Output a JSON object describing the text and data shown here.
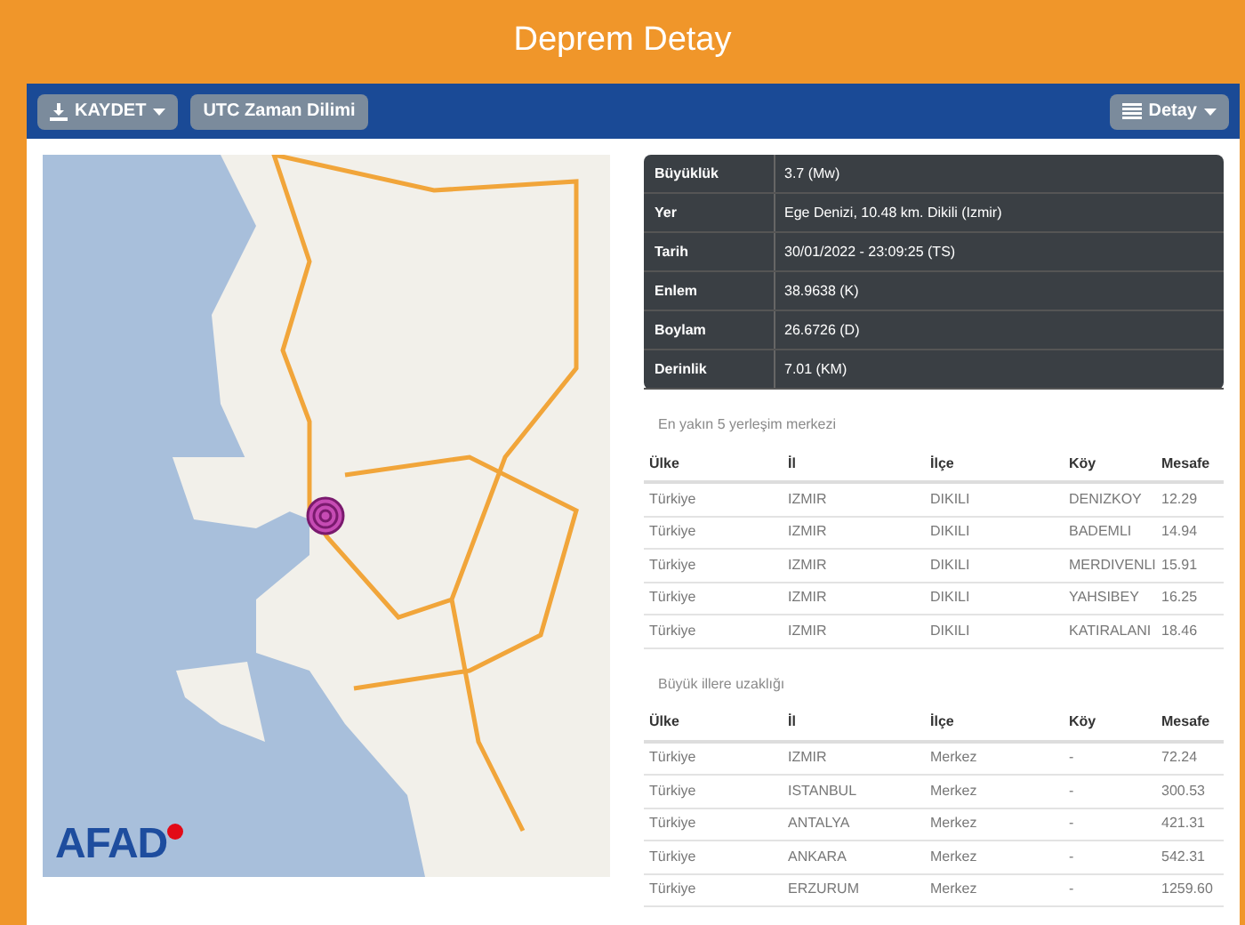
{
  "page_title": "Deprem Detay",
  "toolbar": {
    "left_buttons": [
      {
        "label": "KAYDET",
        "kind": "download-dropdown"
      },
      {
        "label": "UTC Zaman Dilimi",
        "kind": "plain"
      }
    ],
    "right_button": {
      "label": "Detay",
      "kind": "list-dropdown"
    }
  },
  "map": {
    "logo": "AFAD"
  },
  "details": [
    {
      "label": "Büyüklük",
      "value": "3.7 (Mw)"
    },
    {
      "label": "Yer",
      "value": "Ege Denizi, 10.48 km. Dikili (Izmir)"
    },
    {
      "label": "Tarih",
      "value": "30/01/2022 - 23:09:25 (TS)"
    },
    {
      "label": "Enlem",
      "value": "38.9638 (K)"
    },
    {
      "label": "Boylam",
      "value": "26.6726 (D)"
    },
    {
      "label": "Derinlik",
      "value": "7.01 (KM)"
    }
  ],
  "tables": [
    {
      "caption": "En yakın 5 yerleşim merkezi",
      "columns": [
        "Ülke",
        "İl",
        "İlçe",
        "Köy",
        "Mesafe"
      ],
      "rows": [
        [
          "Türkiye",
          "IZMIR",
          "DIKILI",
          "DENIZKOY",
          "12.29"
        ],
        [
          "Türkiye",
          "IZMIR",
          "DIKILI",
          "BADEMLI",
          "14.94"
        ],
        [
          "Türkiye",
          "IZMIR",
          "DIKILI",
          "MERDIVENLI",
          "15.91"
        ],
        [
          "Türkiye",
          "IZMIR",
          "DIKILI",
          "YAHSIBEY",
          "16.25"
        ],
        [
          "Türkiye",
          "IZMIR",
          "DIKILI",
          "KATIRALANI",
          "18.46"
        ]
      ]
    },
    {
      "caption": "Büyük illere uzaklığı",
      "columns": [
        "Ülke",
        "İl",
        "İlçe",
        "Köy",
        "Mesafe"
      ],
      "rows": [
        [
          "Türkiye",
          "IZMIR",
          "Merkez",
          "-",
          "72.24"
        ],
        [
          "Türkiye",
          "ISTANBUL",
          "Merkez",
          "-",
          "300.53"
        ],
        [
          "Türkiye",
          "ANTALYA",
          "Merkez",
          "-",
          "421.31"
        ],
        [
          "Türkiye",
          "ANKARA",
          "Merkez",
          "-",
          "542.31"
        ],
        [
          "Türkiye",
          "ERZURUM",
          "Merkez",
          "-",
          "1259.60"
        ]
      ]
    }
  ]
}
